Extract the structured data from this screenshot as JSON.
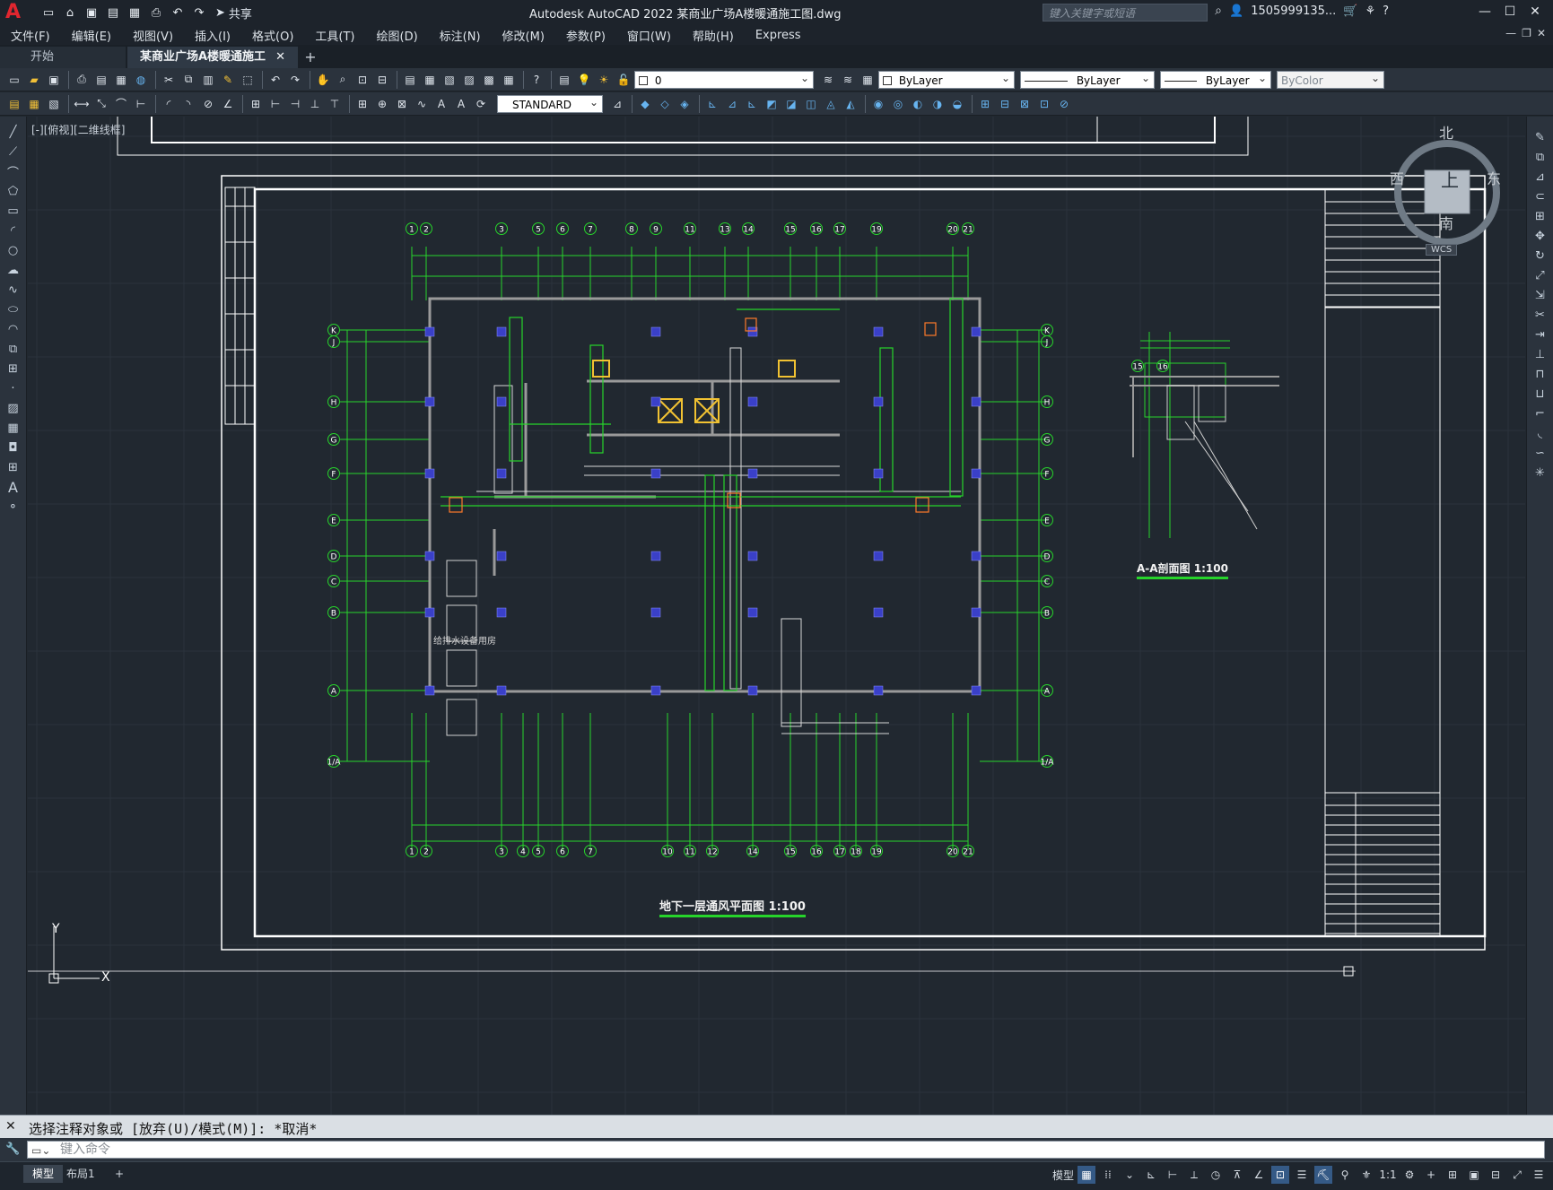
{
  "titlebar": {
    "app_logo": "A",
    "share_label": "共享",
    "title": "Autodesk AutoCAD 2022    某商业广场A楼暖通施工图.dwg",
    "search_placeholder": "键入关键字或短语",
    "user": "1505999135...",
    "icons": [
      "new-icon",
      "open-icon",
      "save-icon",
      "saveas-icon",
      "plot-icon",
      "print-icon",
      "undo-icon",
      "redo-icon"
    ]
  },
  "menu": [
    "文件(F)",
    "编辑(E)",
    "视图(V)",
    "插入(I)",
    "格式(O)",
    "工具(T)",
    "绘图(D)",
    "标注(N)",
    "修改(M)",
    "参数(P)",
    "窗口(W)",
    "帮助(H)",
    "Express"
  ],
  "tabs": [
    {
      "label": "开始",
      "active": false
    },
    {
      "label": "某商业广场A楼暖通施工图*",
      "active": true
    }
  ],
  "toolbar1": {
    "layer_value": "0",
    "color_value": "ByLayer",
    "linetype_value": "ByLayer",
    "lineweight_value": "ByLayer",
    "plotstyle_value": "ByColor"
  },
  "toolbar2": {
    "text_style": "STANDARD"
  },
  "viewport": {
    "view_label": "[-][俯视][二维线框]",
    "compass": {
      "north": "北",
      "south": "南",
      "east": "东",
      "west": "西",
      "center": "上",
      "wcs": "WCS"
    },
    "ucs": {
      "x": "X",
      "y": "Y"
    }
  },
  "drawing": {
    "plan_title": "地下一层通风平面图    1:100",
    "section_title": "A-A剖面图    1:100",
    "room_label": "给排水设备用房",
    "top_axis_labels": [
      "1",
      "2",
      "3",
      "5",
      "6",
      "7",
      "8",
      "9",
      "11",
      "13",
      "14",
      "15",
      "16",
      "17",
      "19",
      "20",
      "21"
    ],
    "bottom_axis_labels": [
      "1",
      "2",
      "3",
      "4",
      "5",
      "6",
      "7",
      "10",
      "11",
      "12",
      "14",
      "15",
      "16",
      "17",
      "18",
      "19",
      "20",
      "21"
    ],
    "left_axis_labels": [
      "K",
      "J",
      "H",
      "G",
      "F",
      "E",
      "D",
      "C",
      "B",
      "A",
      "1/A"
    ],
    "section_axis_labels": [
      "15",
      "16"
    ]
  },
  "command": {
    "history": "选择注释对象或 [放弃(U)/模式(M)]: *取消*",
    "placeholder": "键入命令"
  },
  "status": {
    "tabs": [
      "模型",
      "布局1"
    ],
    "model_label": "模型",
    "scale": "1:1"
  },
  "colors": {
    "canvas": "#212830",
    "green": "#27d42b",
    "white": "#ffffff",
    "blue_col": "#3a40c8",
    "accent": "#355a86"
  }
}
